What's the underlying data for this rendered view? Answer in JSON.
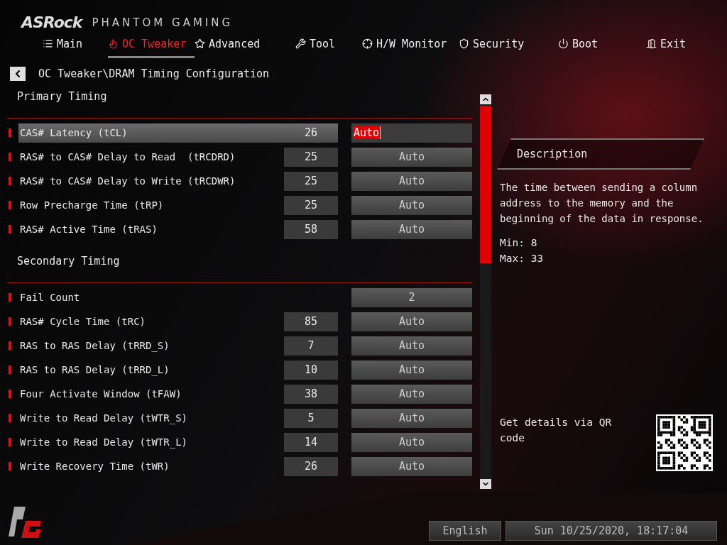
{
  "brand": {
    "logo": "ASRock",
    "subtitle": "PHANTOM GAMING"
  },
  "tabs": [
    {
      "label": "Main",
      "selected": false
    },
    {
      "label": "OC Tweaker",
      "selected": true
    },
    {
      "label": "Advanced",
      "selected": false
    },
    {
      "label": "Tool",
      "selected": false
    },
    {
      "label": "H/W Monitor",
      "selected": false
    },
    {
      "label": "Security",
      "selected": false
    },
    {
      "label": "Boot",
      "selected": false
    },
    {
      "label": "Exit",
      "selected": false
    }
  ],
  "breadcrumb": "OC Tweaker\\DRAM Timing Configuration",
  "sections": [
    {
      "title": "Primary Timing",
      "rows": [
        {
          "label": "CAS# Latency (tCL)",
          "current": "26",
          "setting": "Auto",
          "selected": true
        },
        {
          "label": "RAS# to CAS# Delay to Read  (tRCDRD)",
          "current": "25",
          "setting": "Auto",
          "selected": false
        },
        {
          "label": "RAS# to CAS# Delay to Write (tRCDWR)",
          "current": "25",
          "setting": "Auto",
          "selected": false
        },
        {
          "label": "Row Precharge Time (tRP)",
          "current": "25",
          "setting": "Auto",
          "selected": false
        },
        {
          "label": "RAS# Active Time (tRAS)",
          "current": "58",
          "setting": "Auto",
          "selected": false
        }
      ]
    },
    {
      "title": "Secondary Timing",
      "rows": [
        {
          "label": "Fail Count",
          "setting": "2",
          "selected": false
        },
        {
          "label": "RAS# Cycle Time (tRC)",
          "current": "85",
          "setting": "Auto",
          "selected": false
        },
        {
          "label": "RAS to RAS Delay (tRRD_S)",
          "current": "7",
          "setting": "Auto",
          "selected": false
        },
        {
          "label": "RAS to RAS Delay (tRRD_L)",
          "current": "10",
          "setting": "Auto",
          "selected": false
        },
        {
          "label": "Four Activate Window (tFAW)",
          "current": "38",
          "setting": "Auto",
          "selected": false
        },
        {
          "label": "Write to Read Delay (tWTR_S)",
          "current": "5",
          "setting": "Auto",
          "selected": false
        },
        {
          "label": "Write to Read Delay (tWTR_L)",
          "current": "14",
          "setting": "Auto",
          "selected": false
        },
        {
          "label": "Write Recovery Time (tWR)",
          "current": "26",
          "setting": "Auto",
          "selected": false
        }
      ]
    }
  ],
  "description": {
    "title": "Description",
    "text": "The time between sending a column address to the memory and the beginning of the data in response.",
    "min": "Min: 8",
    "max": "Max: 33"
  },
  "qr": {
    "text": "Get details via QR code"
  },
  "footer": {
    "language": "English",
    "datetime": "Sun 10/25/2020, 18:17:04"
  }
}
